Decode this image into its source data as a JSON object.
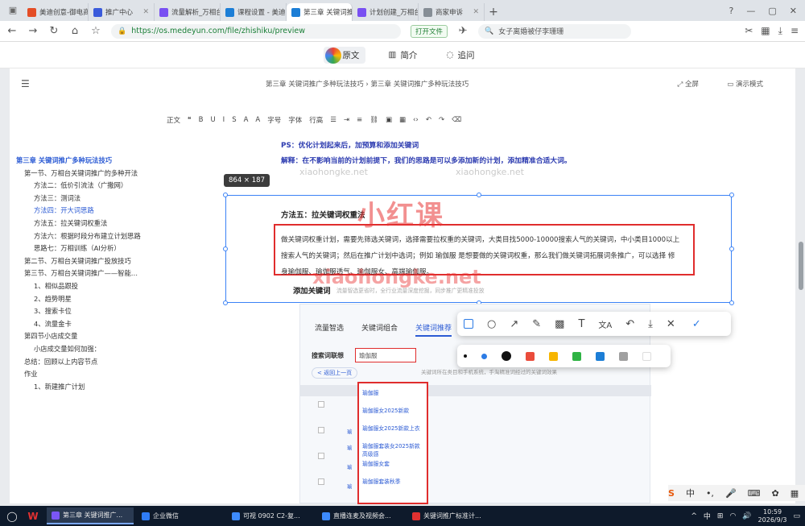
{
  "browser": {
    "tabs": [
      {
        "label": "美迪创意-御电商",
        "color": "#e44d26"
      },
      {
        "label": "推广中心",
        "color": "#3b5bdb"
      },
      {
        "label": "流量解析_万相台",
        "color": "#7950f2"
      },
      {
        "label": "课程设置 - 美迪之",
        "color": "#1c7ed6"
      },
      {
        "label": "第三章 关键词推广",
        "color": "#1c7ed6",
        "active": true
      },
      {
        "label": "计划创建_万相台",
        "color": "#7950f2"
      },
      {
        "label": "商家申诉",
        "color": "#868e96"
      }
    ],
    "url": "https://os.medeyun.com/file/zhishiku/preview",
    "open_file_label": "打开文件",
    "search_text": "女子离婚被仔李珊珊"
  },
  "viewer": {
    "tab_original": "原文",
    "tab_summary": "简介",
    "tab_qa": "追问"
  },
  "doc": {
    "breadcrumb": "第三章 关键词推广多种玩法技巧 › 第三章 关键词推广多种玩法技巧",
    "fullscreen_label": "全屏",
    "present_label": "演示模式",
    "toolbar": [
      "正文",
      "❝",
      "B",
      "U",
      "I",
      "S",
      "A",
      "A",
      "字号",
      "字体",
      "行高"
    ],
    "outline": [
      {
        "text": "第三章 关键词推广多种玩法技巧",
        "kind": "h"
      },
      {
        "text": "第一节、万相台关键词推广的多种开法",
        "kind": "n"
      },
      {
        "text": "方法二：低价引流法（广撒网）",
        "kind": "n"
      },
      {
        "text": "方法三：测词法",
        "kind": "n"
      },
      {
        "text": "方法四：开大词思路",
        "kind": "sel"
      },
      {
        "text": "方法五：拉关键词权重法",
        "kind": "n"
      },
      {
        "text": "方法六：根据时段分布建立计划思路",
        "kind": "n"
      },
      {
        "text": "思路七：万相训练（AI分析）",
        "kind": "n"
      },
      {
        "text": "第二节、万相台关键词推广投放技巧",
        "kind": "n"
      },
      {
        "text": "第三节、万相台关键词推广——智能…",
        "kind": "n"
      },
      {
        "text": "1、相似品跟投",
        "kind": "n"
      },
      {
        "text": "2、趋势明星",
        "kind": "n"
      },
      {
        "text": "3、搜索卡位",
        "kind": "n"
      },
      {
        "text": "4、流量金卡",
        "kind": "n"
      },
      {
        "text": "第四节小店成交量",
        "kind": "n"
      },
      {
        "text": "小店成交量如何加强：",
        "kind": "n"
      },
      {
        "text": "总结：回顾以上内容节点",
        "kind": "n"
      },
      {
        "text": "作业",
        "kind": "n"
      },
      {
        "text": "1、新建推广计划",
        "kind": "n"
      }
    ],
    "ps": "PS：优化计划起来后，加预算和添加关键词",
    "explain": "解释：在不影响当前的计划前提下，我们的思路是可以多添加新的计划，添加精准合适大词。",
    "selection_size": "864 × 187",
    "method5_title": "方法五：拉关键词权重法",
    "method5_body": "做关键词权重计划，需要先筛选关键词，选择需要拉权重的关键词，大类目找5000-10000搜索人气的关键词，中小类目1000以上搜索人气的关键词；然后在推广计划中选词；例如 瑜伽服 是想要做的关键词权重，那么我们做关键词拓展词条推广，可以选择 修身瑜伽服、瑜伽服透气、瑜伽服女、高端瑜伽服。",
    "add_kw_title": "添加关键词",
    "add_kw_sub": "流量智选更省时，全行业流量深度挖掘，同步推广更精准投放",
    "watermark_cn": "小红课",
    "watermark_url": "xiaohongke.net",
    "watermark_small": "xiaohongke.net"
  },
  "inner_shot": {
    "tabs": [
      "流量智选",
      "关键词组合",
      "关键词推荐"
    ],
    "kw_label": "搜索词联想",
    "kw_value": "瑜伽服",
    "back_label": "< 返回上一页",
    "hint": "关键词所在类目和手机系统，手淘精准词经过的关键词效果",
    "suggestions": [
      "瑜伽服",
      "瑜伽服女2025新款",
      "瑜伽服女2025新款上衣",
      "瑜伽服套装女2025新款高级感",
      "瑜伽服女套",
      "瑜伽服套装秋季"
    ],
    "row_tag": "瑜"
  },
  "draw_toolbar": {
    "tools": [
      "rect",
      "circle",
      "arrow",
      "pen",
      "mosaic",
      "text",
      "translate",
      "undo",
      "download",
      "close",
      "confirm"
    ],
    "colors": [
      "#ea4c3b",
      "#f7b500",
      "#2fb344",
      "#1c7ed6",
      "#a0a0a0",
      "#ffffff"
    ]
  },
  "taskbar": {
    "apps": [
      {
        "label": "第三章 关键词推广...",
        "color": "#7a56f5",
        "active": true
      },
      {
        "label": "企业微信",
        "color": "#2f7cf6"
      },
      {
        "label": "可视 0902 C2-复...",
        "color": "#3d8bfd"
      },
      {
        "label": "直播连麦及视频会...",
        "color": "#3d8bfd"
      },
      {
        "label": "关键词推广标准计...",
        "color": "#e03131"
      }
    ],
    "ime": "中",
    "time": "10:59",
    "date": "2026/9/3"
  }
}
